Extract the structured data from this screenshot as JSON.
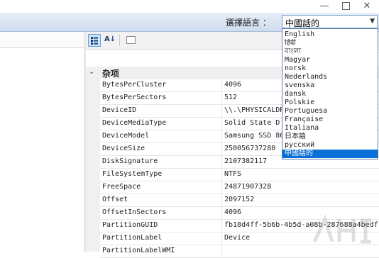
{
  "window": {
    "min": "—",
    "close": "✕"
  },
  "language": {
    "label": "選擇語言 ：",
    "selected": "中國話的"
  },
  "dropdown": {
    "options": [
      "English",
      "हिंदी",
      "বাংলা",
      "Magyar",
      "norsk",
      "Nederlands",
      "svenska",
      "dansk",
      "Polskie",
      "Portuguesa",
      "Française",
      "Italiana",
      "日本語",
      "русский",
      "中國話的"
    ],
    "selected_index": 14
  },
  "grid": {
    "category": "杂项",
    "toggle": "⌄",
    "rows": [
      {
        "key": "BytesPerCluster",
        "value": "4096"
      },
      {
        "key": "BytesPerSectors",
        "value": "512"
      },
      {
        "key": "DeviceID",
        "value": "\\\\.\\PHYSICALDR"
      },
      {
        "key": "DeviceMediaType",
        "value": "Solid State D"
      },
      {
        "key": "DeviceModel",
        "value": "Samsung SSD 86"
      },
      {
        "key": "DeviceSize",
        "value": "250056737280"
      },
      {
        "key": "DiskSignature",
        "value": "2107382117"
      },
      {
        "key": "FileSystemType",
        "value": "NTFS"
      },
      {
        "key": "FreeSpace",
        "value": "24871907328"
      },
      {
        "key": "Offset",
        "value": "2097152"
      },
      {
        "key": "OffsetInSectors",
        "value": "4096"
      },
      {
        "key": "PartitionGUID",
        "value": "fb18d4ff-5b6b-4b5d-a08b-287688a4bedf"
      },
      {
        "key": "PartitionLabel",
        "value": "Device"
      },
      {
        "key": "PartitionLabelWMI",
        "value": ""
      }
    ]
  },
  "toolbar": {
    "categorized_icon": "categorized-icon",
    "alpha_label": "A↓"
  },
  "colors": {
    "selection": "#0a6fd6",
    "bar": "#dbe6f4"
  }
}
